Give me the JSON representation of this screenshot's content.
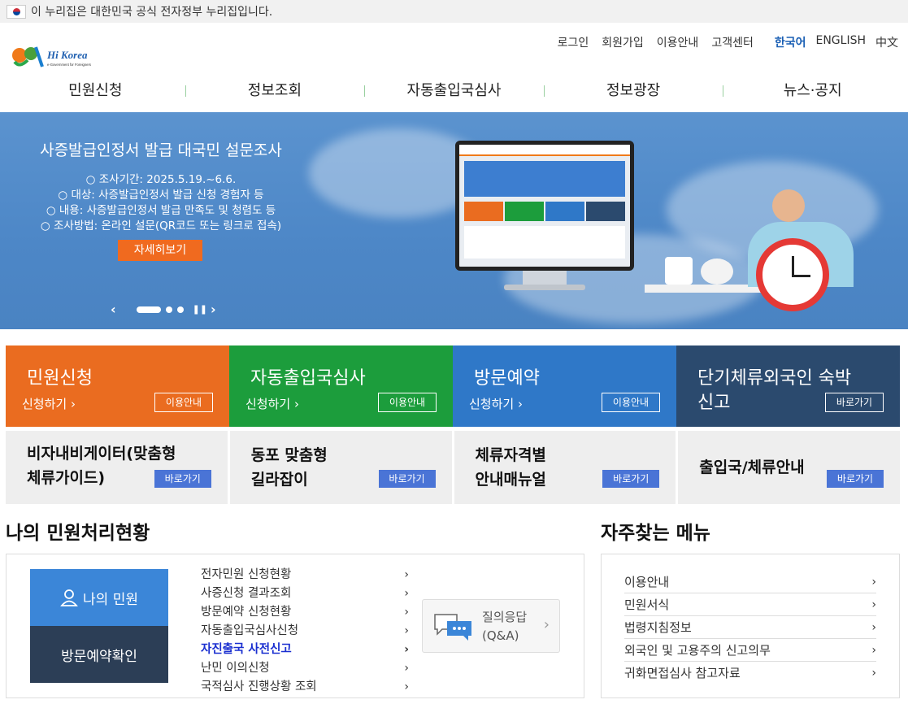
{
  "gov_banner": {
    "text": "이 누리집은 대한민국 공식 전자정부 누리집입니다."
  },
  "logo": {
    "brand": "Hi Korea",
    "tagline": "e-Government for Foreigners"
  },
  "util_nav": {
    "login": "로그인",
    "signup": "회원가입",
    "guide": "이용안내",
    "support": "고객센터"
  },
  "languages": [
    {
      "label": "한국어",
      "active": true
    },
    {
      "label": "ENGLISH",
      "active": false
    },
    {
      "label": "中文",
      "active": false
    }
  ],
  "gnb": [
    "민원신청",
    "정보조회",
    "자동출입국심사",
    "정보광장",
    "뉴스·공지"
  ],
  "hero": {
    "title": "사증발급인정서 발급 대국민 설문조사",
    "lines": [
      "○ 조사기간: 2025.5.19.~6.6.",
      "○ 대상: 사증발급인정서 발급 신청 경험자 등",
      "○ 내용: 사증발급인정서 발급 만족도 및 청렴도 등",
      "○ 조사방법: 온라인 설문(QR코드 또는 링크로 접속)"
    ],
    "button": "자세히보기",
    "slide_total": 3,
    "slide_active": 1
  },
  "tiles": [
    {
      "title": "민원신청",
      "sub": "신청하기",
      "button": "이용안내",
      "color": "#ea6c20"
    },
    {
      "title": "자동출입국심사",
      "sub": "신청하기",
      "button": "이용안내",
      "color": "#1c9d3c"
    },
    {
      "title": "방문예약",
      "sub": "신청하기",
      "button": "이용안내",
      "color": "#2f78c8"
    },
    {
      "title_line1": "단기체류외국인 숙박",
      "title_line2": "신고",
      "button": "바로가기",
      "color": "#2b4a6e"
    }
  ],
  "tiles2": [
    {
      "line1": "비자내비게이터(맞춤형",
      "line2": "체류가이드)",
      "button": "바로가기"
    },
    {
      "line1": "동포 맞춤형",
      "line2": "길라잡이",
      "button": "바로가기"
    },
    {
      "line1": "체류자격별",
      "line2": "안내매뉴얼",
      "button": "바로가기"
    },
    {
      "line1": "출입국/체류안내",
      "button": "바로가기"
    }
  ],
  "status": {
    "title": "나의 민원처리현황",
    "my_button": "나의 민원",
    "visit_button": "방문예약확인",
    "items": [
      "전자민원 신청현황",
      "사증신청 결과조회",
      "방문예약 신청현황",
      "자동출입국심사신청",
      "자진출국 사전신고",
      "난민 이의신청",
      "국적심사 진행상황 조회"
    ],
    "highlight_index": 4,
    "qna_line1": "질의응답",
    "qna_line2": "(Q&A)"
  },
  "faq": {
    "title": "자주찾는 메뉴",
    "items": [
      "이용안내",
      "민원서식",
      "법령지침정보",
      "외국인 및 고용주의 신고의무",
      "귀화면접심사 참고자료"
    ]
  }
}
